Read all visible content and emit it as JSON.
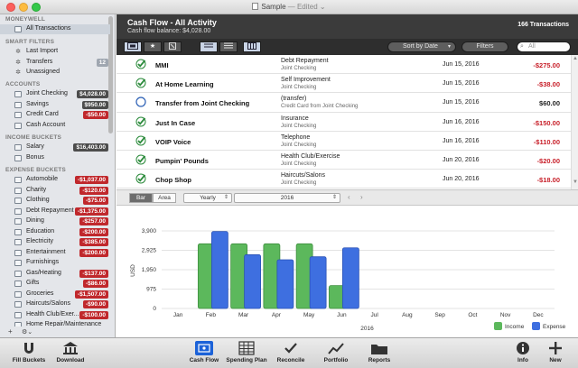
{
  "window": {
    "title": "Sample",
    "edited_label": "— Edited ⌄"
  },
  "sidebar": {
    "sections": {
      "moneywell": "MONEYWELL",
      "smart_filters": "SMART FILTERS",
      "accounts": "ACCOUNTS",
      "income_buckets": "INCOME BUCKETS",
      "expense_buckets": "EXPENSE BUCKETS"
    },
    "all_transactions": "All Transactions",
    "smart_filters": [
      {
        "label": "Last Import",
        "icon": "gear-icon"
      },
      {
        "label": "Transfers",
        "icon": "gear-icon",
        "badge": "12"
      },
      {
        "label": "Unassigned",
        "icon": "gear-icon"
      }
    ],
    "accounts": [
      {
        "label": "Joint Checking",
        "amount": "$4,028.00",
        "kind": "pos"
      },
      {
        "label": "Savings",
        "amount": "$950.00",
        "kind": "pos"
      },
      {
        "label": "Credit Card",
        "amount": "-$50.00",
        "kind": "neg"
      },
      {
        "label": "Cash Account",
        "amount": "",
        "kind": "none"
      }
    ],
    "income_buckets": [
      {
        "label": "Salary",
        "amount": "$16,403.00",
        "kind": "pos"
      },
      {
        "label": "Bonus",
        "amount": "",
        "kind": "none"
      }
    ],
    "expense_buckets": [
      {
        "label": "Automobile",
        "amount": "-$1,037.00",
        "kind": "neg"
      },
      {
        "label": "Charity",
        "amount": "-$120.00",
        "kind": "neg"
      },
      {
        "label": "Clothing",
        "amount": "-$75.00",
        "kind": "neg"
      },
      {
        "label": "Debt Repayment",
        "amount": "-$1,375.00",
        "kind": "neg"
      },
      {
        "label": "Dining",
        "amount": "-$257.00",
        "kind": "neg"
      },
      {
        "label": "Education",
        "amount": "-$200.00",
        "kind": "neg"
      },
      {
        "label": "Electricity",
        "amount": "-$385.00",
        "kind": "neg"
      },
      {
        "label": "Entertainment",
        "amount": "-$200.00",
        "kind": "neg"
      },
      {
        "label": "Furnishings",
        "amount": "",
        "kind": "none"
      },
      {
        "label": "Gas/Heating",
        "amount": "-$137.00",
        "kind": "neg"
      },
      {
        "label": "Gifts",
        "amount": "-$86.00",
        "kind": "neg"
      },
      {
        "label": "Groceries",
        "amount": "-$1,507.00",
        "kind": "neg"
      },
      {
        "label": "Haircuts/Salons",
        "amount": "-$90.00",
        "kind": "neg"
      },
      {
        "label": "Health Club/Exer...",
        "amount": "-$100.00",
        "kind": "neg"
      },
      {
        "label": "Home Repair/Maintenance",
        "amount": "",
        "kind": "none"
      }
    ],
    "footer": {
      "add": "+",
      "gear": "⚙⌄"
    }
  },
  "header": {
    "title": "Cash Flow - All Activity",
    "subtitle": "Cash flow balance: $4,028.00",
    "count": "166 Transactions"
  },
  "toolbar": {
    "sort_label": "Sort by Date",
    "filters_label": "Filters",
    "search_placeholder": "All"
  },
  "transactions": [
    {
      "payee": "MMI",
      "category": "Debt Repayment",
      "account": "Joint Checking",
      "date": "Jun 15, 2016",
      "amount": "-$275.00",
      "kind": "neg",
      "cleared": true
    },
    {
      "payee": "At Home Learning",
      "category": "Self Improvement",
      "account": "Joint Checking",
      "date": "Jun 15, 2016",
      "amount": "-$38.00",
      "kind": "neg",
      "cleared": true
    },
    {
      "payee": "Transfer from Joint Checking",
      "category": "(transfer)",
      "account": "Credit Card from Joint Checking",
      "date": "Jun 15, 2016",
      "amount": "$60.00",
      "kind": "pos",
      "cleared": false
    },
    {
      "payee": "Just In Case",
      "category": "Insurance",
      "account": "Joint Checking",
      "date": "Jun 16, 2016",
      "amount": "-$150.00",
      "kind": "neg",
      "cleared": true
    },
    {
      "payee": "VOIP Voice",
      "category": "Telephone",
      "account": "Joint Checking",
      "date": "Jun 16, 2016",
      "amount": "-$110.00",
      "kind": "neg",
      "cleared": true
    },
    {
      "payee": "Pumpin' Pounds",
      "category": "Health Club/Exercise",
      "account": "Joint Checking",
      "date": "Jun 20, 2016",
      "amount": "-$20.00",
      "kind": "neg",
      "cleared": true
    },
    {
      "payee": "Chop Shop",
      "category": "Haircuts/Salons",
      "account": "Joint Checking",
      "date": "Jun 20, 2016",
      "amount": "-$18.00",
      "kind": "neg",
      "cleared": true
    }
  ],
  "chart_controls": {
    "bar_label": "Bar",
    "area_label": "Area",
    "period": "Yearly",
    "year": "2016"
  },
  "chart_data": {
    "type": "bar",
    "categories": [
      "Jan",
      "Feb",
      "Mar",
      "Apr",
      "May",
      "Jun",
      "Jul",
      "Aug",
      "Sep",
      "Oct",
      "Nov",
      "Dec"
    ],
    "series": [
      {
        "name": "Income",
        "color": "#5cb85c",
        "values": [
          0,
          3250,
          3250,
          3250,
          3250,
          1150,
          0,
          0,
          0,
          0,
          0,
          0
        ]
      },
      {
        "name": "Expense",
        "color": "#3e6fe0",
        "values": [
          0,
          3870,
          2700,
          2450,
          2600,
          3050,
          0,
          0,
          0,
          0,
          0,
          0
        ]
      }
    ],
    "xlabel": "2016",
    "ylabel": "USD",
    "yticks": [
      "0",
      "975",
      "1,950",
      "2,925",
      "3,900"
    ],
    "ylim": [
      0,
      3900
    ],
    "grid": true,
    "legend": "bottom-right"
  },
  "bottom_toolbar": {
    "fill_buckets": "Fill Buckets",
    "download": "Download",
    "cash_flow": "Cash Flow",
    "spending_plan": "Spending Plan",
    "reconcile": "Reconcile",
    "portfolio": "Portfolio",
    "reports": "Reports",
    "info": "Info",
    "new": "New"
  }
}
